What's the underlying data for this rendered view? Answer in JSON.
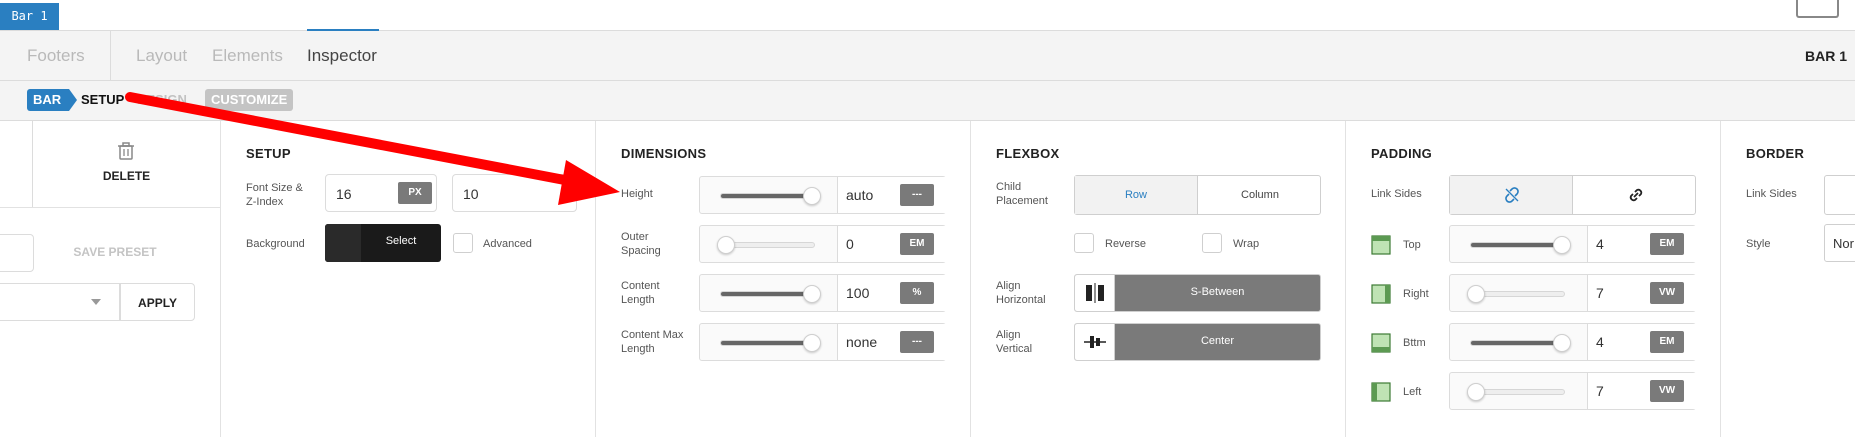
{
  "top": {
    "bar_tag": "Bar 1"
  },
  "nav": {
    "items": [
      {
        "label": "Footers",
        "active": false
      },
      {
        "label": "Layout",
        "active": false
      },
      {
        "label": "Elements",
        "active": false
      },
      {
        "label": "Inspector",
        "active": true
      }
    ],
    "right_label": "BAR 1"
  },
  "breadcrumb": {
    "bar": "BAR",
    "setup": "SETUP",
    "design": "DESIGN",
    "customize": "CUSTOMIZE"
  },
  "preset_panel": {
    "delete_label": "DELETE",
    "save_preset_label": "SAVE PRESET",
    "apply_label": "APPLY"
  },
  "setup_panel": {
    "title": "SETUP",
    "font_size_label_1": "Font Size &",
    "font_size_label_2": "Z-Index",
    "font_size_value": "16",
    "font_size_unit": "PX",
    "z_index_value": "10",
    "background_label": "Background",
    "select_label": "Select",
    "advanced_label": "Advanced"
  },
  "dimensions_panel": {
    "title": "DIMENSIONS",
    "rows": [
      {
        "label1": "Height",
        "label2": "",
        "value": "auto",
        "unit": "---",
        "slider": 0.95
      },
      {
        "label1": "Outer",
        "label2": "Spacing",
        "value": "0",
        "unit": "EM",
        "slider": 0.0
      },
      {
        "label1": "Content",
        "label2": "Length",
        "value": "100",
        "unit": "%",
        "slider": 0.95
      },
      {
        "label1": "Content Max",
        "label2": "Length",
        "value": "none",
        "unit": "---",
        "slider": 0.95
      }
    ]
  },
  "flexbox_panel": {
    "title": "FLEXBOX",
    "child_placement_1": "Child",
    "child_placement_2": "Placement",
    "row_label": "Row",
    "column_label": "Column",
    "reverse_label": "Reverse",
    "wrap_label": "Wrap",
    "align_h_1": "Align",
    "align_h_2": "Horizontal",
    "align_h_value": "S-Between",
    "align_v_1": "Align",
    "align_v_2": "Vertical",
    "align_v_value": "Center"
  },
  "padding_panel": {
    "title": "PADDING",
    "link_sides_label": "Link Sides",
    "rows": [
      {
        "label": "Top",
        "value": "4",
        "unit": "EM",
        "slider": 0.95
      },
      {
        "label": "Right",
        "value": "7",
        "unit": "VW",
        "slider": 0.0
      },
      {
        "label": "Bttm",
        "value": "4",
        "unit": "EM",
        "slider": 0.95
      },
      {
        "label": "Left",
        "value": "7",
        "unit": "VW",
        "slider": 0.0
      }
    ]
  },
  "border_panel": {
    "title": "BORDER",
    "link_sides_label": "Link Sides",
    "style_label": "Style",
    "style_value": "Nor"
  },
  "colors": {
    "accent": "#2a7fc1",
    "arrow": "#ff0000",
    "dark_button": "#1a1a1a",
    "unit_badge": "#7a7a7a"
  }
}
